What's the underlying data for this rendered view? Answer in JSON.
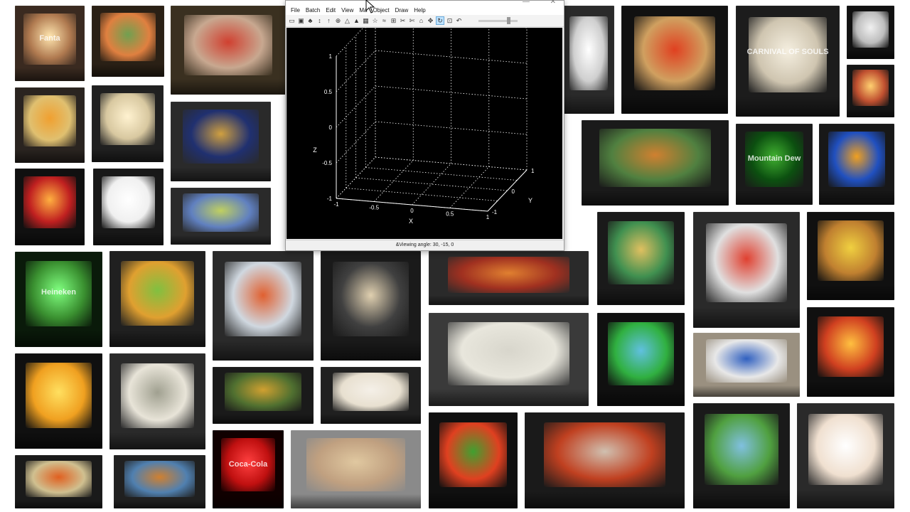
{
  "window": {
    "menus": [
      "File",
      "Batch",
      "Edit",
      "View",
      "Ma",
      "Object",
      "Draw",
      "Help"
    ],
    "controls": [
      "—",
      "✕"
    ],
    "status": "&Viewing angle: 30, -15, 0"
  },
  "toolbar": {
    "icons": [
      "new-icon",
      "save-icon",
      "tree-icon",
      "arrow-icon",
      "pin-icon",
      "mesh-icon",
      "cone-icon",
      "fill-icon",
      "image-icon",
      "star-icon",
      "wave-icon",
      "grid-icon",
      "cut-icon",
      "scissors-icon",
      "shape-icon",
      "move-icon",
      "rotate-icon",
      "zoom-icon",
      "undo-icon"
    ]
  },
  "plot": {
    "zlabel": "Z",
    "xlabel": "X",
    "ylabel": "Y",
    "zticks": [
      "1",
      "0.5",
      "0",
      "-0.5",
      "-1"
    ],
    "xticks": [
      "-1",
      "-0.5",
      "0",
      "0.5",
      "1"
    ],
    "yticks": [
      "1",
      "0",
      "-1"
    ]
  },
  "tiles": [
    {
      "name": "fanta-can-lamp",
      "text": "Fanta"
    },
    {
      "name": "birds-flowers-panel"
    },
    {
      "name": "robins-panel"
    },
    {
      "name": "white-vase-lamp"
    },
    {
      "name": "flowers-cube-lamp"
    },
    {
      "name": "carnival-of-souls-lamp",
      "text": "CARNIVAL OF SOULS"
    },
    {
      "name": "white-cup-lamp"
    },
    {
      "name": "small-cube-lamp"
    },
    {
      "name": "art-tile-lamp"
    },
    {
      "name": "white-fish-lamp"
    },
    {
      "name": "starry-night-panel"
    },
    {
      "name": "kingfishers-panel"
    },
    {
      "name": "mountain-dew-lamp",
      "text": "Mountain Dew"
    },
    {
      "name": "planets-panel"
    },
    {
      "name": "mario-frame-lamp"
    },
    {
      "name": "bottle-lamp"
    },
    {
      "name": "iris-panel"
    },
    {
      "name": "heineken-can-lamp",
      "text": "Heineken"
    },
    {
      "name": "sunflower-cube-lamp"
    },
    {
      "name": "yoshi-frame"
    },
    {
      "name": "dragons-frame"
    },
    {
      "name": "orange-flowers-panel"
    },
    {
      "name": "triangular-lamp"
    },
    {
      "name": "koi-panel"
    },
    {
      "name": "seahorse-panel"
    },
    {
      "name": "butterfly-sunflower-lamp"
    },
    {
      "name": "floral-lineart-panel"
    },
    {
      "name": "forest-panel"
    },
    {
      "name": "figurines"
    },
    {
      "name": "city-map-model"
    },
    {
      "name": "kingfisher-dive-frame"
    },
    {
      "name": "homer-figurine"
    },
    {
      "name": "mario-lamp-2"
    },
    {
      "name": "cube-pendant-lamp"
    },
    {
      "name": "rainbow-panel"
    },
    {
      "name": "coca-cola-can-lamp",
      "text": "Coca-Cola"
    },
    {
      "name": "mona-lisa-heart"
    },
    {
      "name": "mario-yoshi-lamp"
    },
    {
      "name": "spider-panel"
    },
    {
      "name": "birds-garden-panel"
    },
    {
      "name": "cone-shade-lamp"
    }
  ]
}
